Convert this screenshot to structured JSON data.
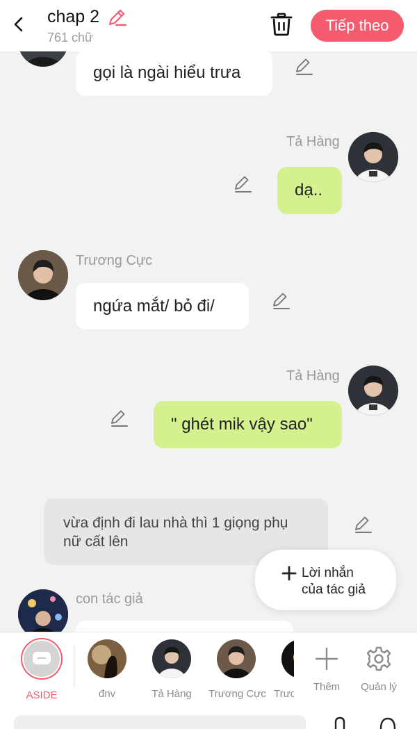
{
  "header": {
    "title": "chap 2",
    "word_count": "761 chữ",
    "next_label": "Tiếp theo"
  },
  "messages": [
    {
      "id": 0,
      "speaker": "",
      "text": "gọi là ngài hiểu trưa",
      "side": "left",
      "style": "white"
    },
    {
      "id": 1,
      "speaker": "Tả Hàng",
      "text": "dạ..",
      "side": "right",
      "style": "green"
    },
    {
      "id": 2,
      "speaker": "Trương Cực",
      "text": "ngứa mắt/ bỏ đi/",
      "side": "left",
      "style": "white"
    },
    {
      "id": 3,
      "speaker": "Tả Hàng",
      "text": "\" ghét mik vậy sao\"",
      "side": "right",
      "style": "green"
    },
    {
      "id": 4,
      "speaker": "",
      "text": "vừa định đi lau nhà thì 1 giọng phụ nữ cất lên",
      "side": "center",
      "style": "narration"
    },
    {
      "id": 5,
      "speaker": "con tác giả",
      "text": "",
      "side": "left",
      "style": "white"
    }
  ],
  "author_note_button": {
    "label": "Lời nhắn\ncủa tác giả"
  },
  "characters": [
    {
      "label": "ASIDE",
      "selected": true
    },
    {
      "label": "đnv"
    },
    {
      "label": "Tả Hàng"
    },
    {
      "label": "Trương Cực"
    },
    {
      "label": "Trươ"
    }
  ],
  "actions": {
    "add_label": "Thêm",
    "manage_label": "Quản lý"
  },
  "colors": {
    "accent": "#f45b6f",
    "bubble_green": "#d5f18f",
    "bubble_white": "#ffffff",
    "narration_bg": "#e6e6e6",
    "background": "#f2f2f2"
  }
}
